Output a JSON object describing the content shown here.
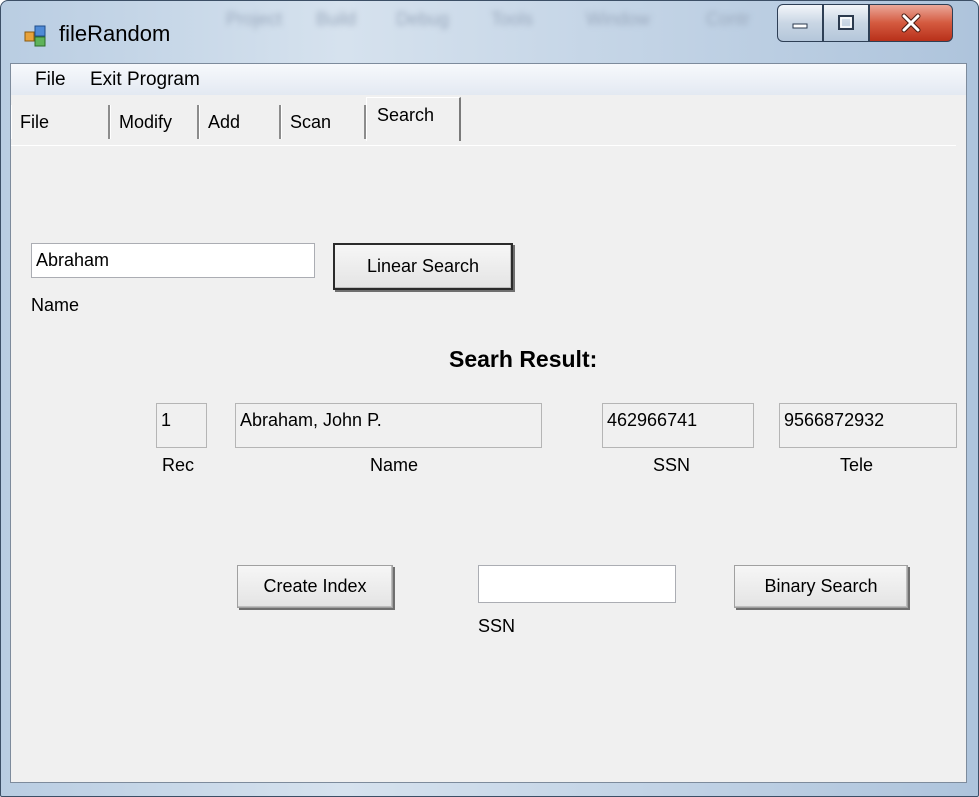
{
  "window": {
    "title": "fileRandom",
    "ghost_menu": [
      "Project",
      "Build",
      "Debug",
      "Tools",
      "Window",
      "Contr"
    ]
  },
  "menubar": {
    "items": [
      "File",
      "Exit Program"
    ]
  },
  "tabs": [
    "File",
    "Modify",
    "Add",
    "Scan",
    "Search"
  ],
  "active_tab": "Search",
  "search": {
    "name_value": "Abraham",
    "name_label": "Name",
    "linear_button": "Linear Search"
  },
  "result": {
    "title": "Searh Result:",
    "rec_value": "1",
    "rec_label": "Rec",
    "name_value": "Abraham, John P.",
    "name_label": "Name",
    "ssn_value": "462966741",
    "ssn_label": "SSN",
    "tele_value": "9566872932",
    "tele_label": "Tele"
  },
  "index": {
    "create_button": "Create Index",
    "ssn_value": "",
    "ssn_label": "SSN",
    "binary_button": "Binary Search"
  },
  "colors": {
    "close_button": "#c9432a",
    "frame": "#c6d6e7",
    "client": "#f0f0f0"
  },
  "icons": [
    "app-icon",
    "minimize-icon",
    "maximize-icon",
    "close-icon"
  ]
}
